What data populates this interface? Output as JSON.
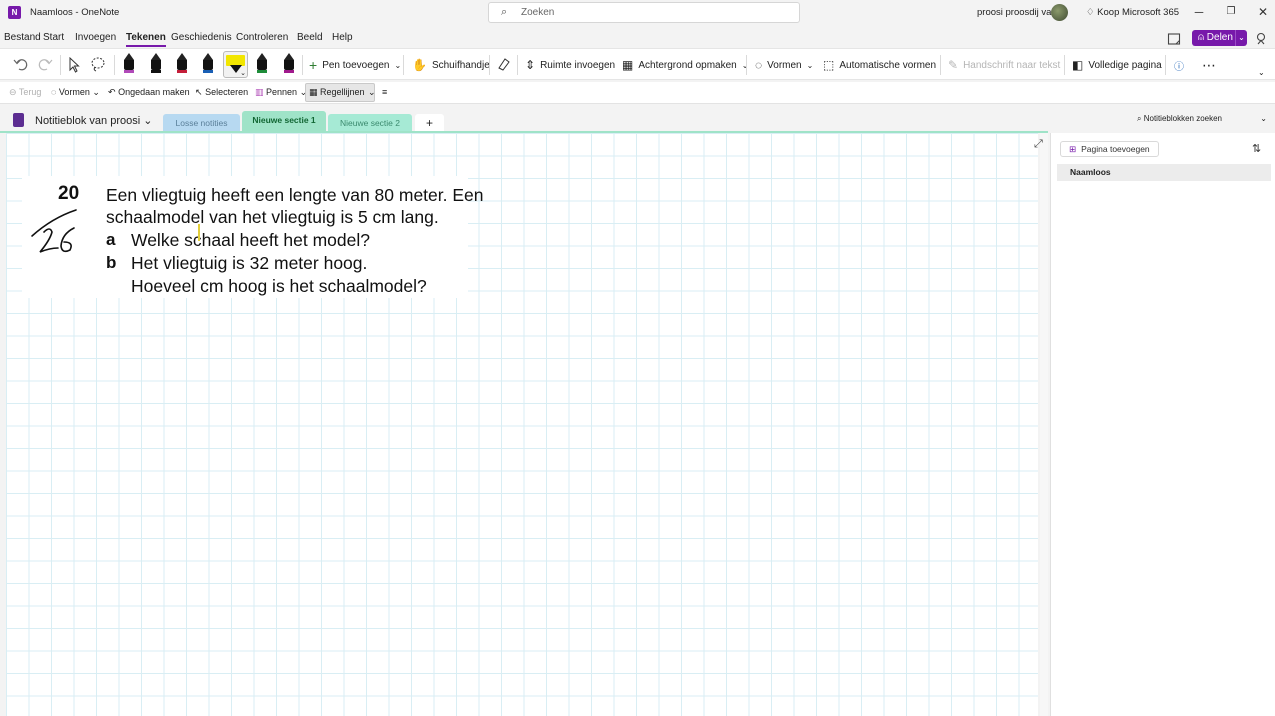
{
  "window": {
    "title": "Naamloos",
    "separator": "-",
    "app": "OneNote",
    "search_placeholder": "Zoeken",
    "user_name": "proosi proosdij van",
    "buy_label": "Koop Microsoft 365"
  },
  "menu": {
    "items": [
      "Bestand",
      "Start",
      "Invoegen",
      "Tekenen",
      "Geschiedenis",
      "Controleren",
      "Beeld",
      "Help"
    ],
    "active": "Tekenen",
    "share_label": "Delen"
  },
  "ribbon": {
    "add_pen": "Pen toevoegen",
    "pan": "Schuifhandje",
    "insert_space": "Ruimte invoegen",
    "background": "Achtergrond opmaken",
    "shapes": "Vormen",
    "auto_shapes": "Automatische vormen",
    "ink_to_text": "Handschrift naar tekst",
    "full_page": "Volledige pagina",
    "pen_colors": [
      "#b04ab8",
      "#111111",
      "#c41e3a",
      "#1a5fb4",
      "#f2e600",
      "#1e8c3a",
      "#a01a8c"
    ]
  },
  "toolbar2": {
    "back": "Terug",
    "shapes": "Vormen",
    "undo": "Ongedaan maken",
    "select": "Selecteren",
    "pens": "Pennen",
    "rule_lines": "Regellijnen"
  },
  "notebook": {
    "name": "Notitieblok van proosi",
    "sections": [
      {
        "label": "Losse notities",
        "color": "#b7d9f1"
      },
      {
        "label": "Nieuwe sectie 1",
        "color": "#9fe3c8"
      },
      {
        "label": "Nieuwe sectie 2",
        "color": "#a6ead5"
      }
    ],
    "add_section": "+",
    "search_placeholder": "Notitieblokken zoeken"
  },
  "note": {
    "number": "20",
    "line1": "Een vliegtuig heeft een lengte van 80 meter. Een",
    "line2": "schaalmodel van het vliegtuig is 5 cm lang.",
    "a_letter": "a",
    "a_text": "Welke schaal heeft het model?",
    "b_letter": "b",
    "b_text": "Het vliegtuig is 32 meter hoog.",
    "b_text2": "Hoeveel cm hoog is het schaalmodel?"
  },
  "pages_panel": {
    "add_page": "Pagina toevoegen",
    "pages": [
      "Naamloos"
    ]
  }
}
